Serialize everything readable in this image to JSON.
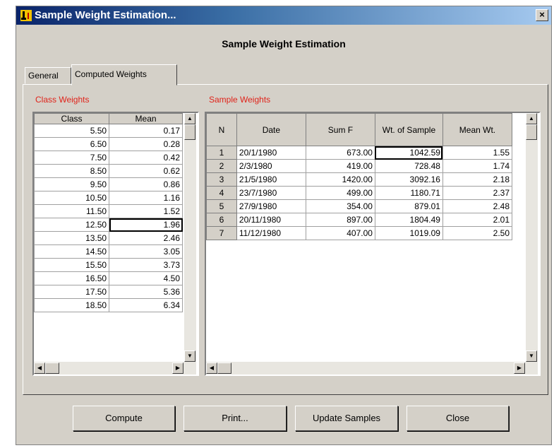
{
  "window": {
    "title": "Sample Weight Estimation...",
    "close_label": "×"
  },
  "heading": "Sample Weight Estimation",
  "tabs": [
    {
      "label": "General"
    },
    {
      "label": "Computed Weights"
    }
  ],
  "active_tab": "Computed Weights",
  "class_weights": {
    "label": "Class Weights",
    "columns": [
      "Class",
      "Mean"
    ],
    "rows": [
      [
        "5.50",
        "0.17"
      ],
      [
        "6.50",
        "0.28"
      ],
      [
        "7.50",
        "0.42"
      ],
      [
        "8.50",
        "0.62"
      ],
      [
        "9.50",
        "0.86"
      ],
      [
        "10.50",
        "1.16"
      ],
      [
        "11.50",
        "1.52"
      ],
      [
        "12.50",
        "1.96"
      ],
      [
        "13.50",
        "2.46"
      ],
      [
        "14.50",
        "3.05"
      ],
      [
        "15.50",
        "3.73"
      ],
      [
        "16.50",
        "4.50"
      ],
      [
        "17.50",
        "5.36"
      ],
      [
        "18.50",
        "6.34"
      ]
    ],
    "selected_cell": "1.96"
  },
  "sample_weights": {
    "label": "Sample Weights",
    "columns": [
      "N",
      "Date",
      "Sum F",
      "Wt. of Sample",
      "Mean Wt."
    ],
    "rows": [
      [
        "1",
        "20/1/1980",
        "673.00",
        "1042.59",
        "1.55"
      ],
      [
        "2",
        "2/3/1980",
        "419.00",
        "728.48",
        "1.74"
      ],
      [
        "3",
        "21/5/1980",
        "1420.00",
        "3092.16",
        "2.18"
      ],
      [
        "4",
        "23/7/1980",
        "499.00",
        "1180.71",
        "2.37"
      ],
      [
        "5",
        "27/9/1980",
        "354.00",
        "879.01",
        "2.48"
      ],
      [
        "6",
        "20/11/1980",
        "897.00",
        "1804.49",
        "2.01"
      ],
      [
        "7",
        "11/12/1980",
        "407.00",
        "1019.09",
        "2.50"
      ]
    ],
    "selected_cell": "1042.59"
  },
  "buttons": {
    "compute": "Compute",
    "print": "Print...",
    "update_samples": "Update Samples",
    "close": "Close"
  },
  "colors": {
    "title_bar": "#0a246a",
    "section_label": "#e0231a",
    "face": "#d4d0c8"
  }
}
